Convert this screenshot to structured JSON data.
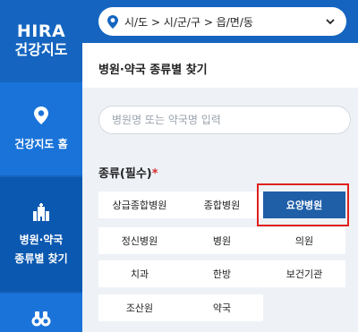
{
  "sidebar": {
    "logo": {
      "line1": "HIRA",
      "line2": "건강지도"
    },
    "items": [
      {
        "label": "건강지도 홈",
        "icon": "location-pin-icon"
      },
      {
        "label_line1": "병원·약국",
        "label_line2": "종류별 찾기",
        "icon": "hospital-building-icon"
      },
      {
        "icon": "binoculars-icon"
      }
    ]
  },
  "location": {
    "text": "시/도 > 시/군/구 > 읍/면/동"
  },
  "section": {
    "title": "병원·약국 종류별 찾기"
  },
  "search": {
    "placeholder": "병원명 또는 약국명 입력",
    "value": ""
  },
  "kind": {
    "label": "종류(필수)",
    "required_mark": "*"
  },
  "categories": [
    {
      "label": "상급종합병원",
      "selected": false
    },
    {
      "label": "종합병원",
      "selected": false
    },
    {
      "label": "요양병원",
      "selected": true
    },
    {
      "label": "정신병원",
      "selected": false
    },
    {
      "label": "병원",
      "selected": false
    },
    {
      "label": "의원",
      "selected": false
    },
    {
      "label": "치과",
      "selected": false
    },
    {
      "label": "한방",
      "selected": false
    },
    {
      "label": "보건기관",
      "selected": false
    },
    {
      "label": "조산원",
      "selected": false
    },
    {
      "label": "약국",
      "selected": false
    }
  ],
  "colors": {
    "brand": "#1565c0",
    "selected": "#1f5fa8",
    "highlight": "#e0201c"
  }
}
